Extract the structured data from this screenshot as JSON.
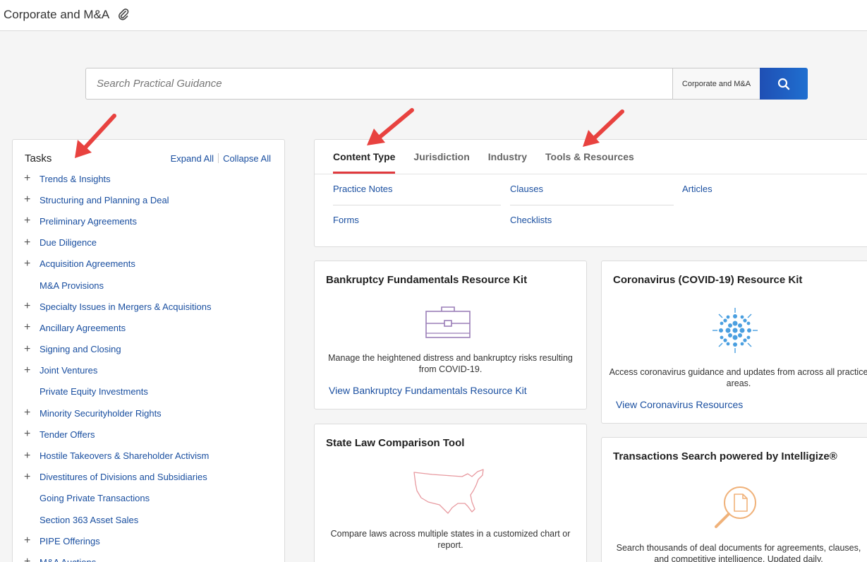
{
  "header": {
    "title": "Corporate and M&A",
    "icon": "paperclip-icon"
  },
  "search": {
    "placeholder": "Search Practical Guidance",
    "scope": "Corporate and M&A",
    "button_icon": "search-icon"
  },
  "tasks": {
    "title": "Tasks",
    "expand_all": "Expand All",
    "collapse_all": "Collapse All",
    "items": [
      {
        "label": "Trends & Insights",
        "expandable": true
      },
      {
        "label": "Structuring and Planning a Deal",
        "expandable": true
      },
      {
        "label": "Preliminary Agreements",
        "expandable": true
      },
      {
        "label": "Due Diligence",
        "expandable": true
      },
      {
        "label": "Acquisition Agreements",
        "expandable": true
      },
      {
        "label": "M&A Provisions",
        "expandable": false
      },
      {
        "label": "Specialty Issues in Mergers & Acquisitions",
        "expandable": true
      },
      {
        "label": "Ancillary Agreements",
        "expandable": true
      },
      {
        "label": "Signing and Closing",
        "expandable": true
      },
      {
        "label": "Joint Ventures",
        "expandable": true
      },
      {
        "label": "Private Equity Investments",
        "expandable": false
      },
      {
        "label": "Minority Securityholder Rights",
        "expandable": true
      },
      {
        "label": "Tender Offers",
        "expandable": true
      },
      {
        "label": "Hostile Takeovers & Shareholder Activism",
        "expandable": true
      },
      {
        "label": "Divestitures of Divisions and Subsidiaries",
        "expandable": true
      },
      {
        "label": "Going Private Transactions",
        "expandable": false
      },
      {
        "label": "Section 363 Asset Sales",
        "expandable": false
      },
      {
        "label": "PIPE Offerings",
        "expandable": true
      },
      {
        "label": "M&A Auctions",
        "expandable": true
      }
    ]
  },
  "content_type": {
    "tabs": [
      "Content Type",
      "Jurisdiction",
      "Industry",
      "Tools & Resources"
    ],
    "active_tab": "Content Type",
    "links": [
      "Practice Notes",
      "Clauses",
      "Articles",
      "Forms",
      "Checklists"
    ]
  },
  "cards": {
    "bankruptcy": {
      "title": "Bankruptcy Fundamentals Resource Kit",
      "description": "Manage the heightened distress and bankruptcy risks resulting from COVID-19.",
      "link": "View Bankruptcy Fundamentals Resource Kit",
      "icon": "briefcase-icon"
    },
    "coronavirus": {
      "title": "Coronavirus (COVID-19) Resource Kit",
      "description": "Access coronavirus guidance and updates from across all practice areas.",
      "link": "View Coronavirus Resources",
      "icon": "virus-icon"
    },
    "state_law": {
      "title": "State Law Comparison Tool",
      "description": "Compare laws across multiple states in a customized chart or report.",
      "icon": "us-map-icon"
    },
    "transactions": {
      "title": "Transactions Search powered by Intelligize®",
      "description": "Search thousands of deal documents for agreements, clauses, and competitive intelligence. Updated daily.",
      "icon": "document-search-icon"
    }
  },
  "colors": {
    "link": "#1a4fa0",
    "active_tab": "#e03a3e",
    "search_button": "#1f5fc4",
    "annotation_arrow": "#e8423f"
  }
}
